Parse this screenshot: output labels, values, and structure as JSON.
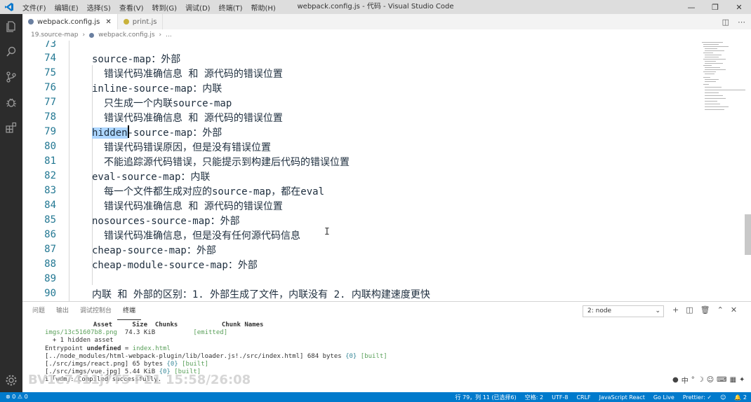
{
  "titlebar": {
    "menu": [
      "文件(F)",
      "编辑(E)",
      "选择(S)",
      "查看(V)",
      "转到(G)",
      "调试(D)",
      "终端(T)",
      "帮助(H)"
    ],
    "title": "webpack.config.js - 代码 - Visual Studio Code"
  },
  "tabs": [
    {
      "label": "webpack.config.js",
      "active": true
    },
    {
      "label": "print.js",
      "active": false
    }
  ],
  "breadcrumb": {
    "folder": "19.source-map",
    "file": "webpack.config.js",
    "more": "..."
  },
  "editor": {
    "lines": [
      {
        "num": "73",
        "text": ""
      },
      {
        "num": "74",
        "text": "source-map：外部"
      },
      {
        "num": "75",
        "text": "错误代码准确信息 和 源代码的错误位置"
      },
      {
        "num": "76",
        "text": "inline-source-map：内联"
      },
      {
        "num": "77",
        "text": "只生成一个内联source-map"
      },
      {
        "num": "78",
        "text": "错误代码准确信息 和 源代码的错误位置"
      },
      {
        "num": "79",
        "text": "hidden",
        "rest": "-source-map：外部"
      },
      {
        "num": "80",
        "text": "错误代码错误原因，但是没有错误位置"
      },
      {
        "num": "81",
        "text": "不能追踪源代码错误，只能提示到构建后代码的错误位置"
      },
      {
        "num": "82",
        "text": "eval-source-map：内联"
      },
      {
        "num": "83",
        "text": "每一个文件都生成对应的source-map，都在eval"
      },
      {
        "num": "84",
        "text": "错误代码准确信息 和 源代码的错误位置"
      },
      {
        "num": "85",
        "text": "nosources-source-map：外部"
      },
      {
        "num": "86",
        "text": "错误代码准确信息，但是没有任何源代码信息"
      },
      {
        "num": "87",
        "text": "cheap-source-map：外部"
      },
      {
        "num": "88",
        "text": "cheap-module-source-map：外部"
      },
      {
        "num": "89",
        "text": ""
      },
      {
        "num": "90",
        "text": "内联 和 外部的区别：1. 外部生成了文件，内联没有 2. 内联构建速度更快"
      }
    ]
  },
  "panel": {
    "tabs": [
      "问题",
      "输出",
      "调试控制台",
      "终端"
    ],
    "terminal_select": "2: node",
    "terminal": {
      "header": {
        "asset": "Asset",
        "size": "Size",
        "chunks": "Chunks",
        "chunk_names": "Chunk Names"
      },
      "row1": {
        "asset": "imgs/13c51607b8.png",
        "size": "74.3 KiB",
        "emitted": "[emitted]"
      },
      "hidden": "+ 1 hidden asset",
      "entry_prefix": "Entrypoint",
      "entry_undef": "undefined",
      "entry_eq": "=",
      "entry_file": "index.html",
      "mod1": "[../node_modules/html-webpack-plugin/lib/loader.js!./src/index.html]",
      "mod1_size": "684 bytes",
      "mod1_chunk": "{0}",
      "mod1_built": "[built]",
      "mod2": "[./src/imgs/react.png]",
      "mod2_size": "65 bytes",
      "mod2_chunk": "{0}",
      "mod2_built": "[built]",
      "mod3": "[./src/imgs/vue.jpg]",
      "mod3_size": "5.44 KiB",
      "mod3_chunk": "{0}",
      "mod3_built": "[built]",
      "wdm": "i ｢wdm｣: Compiled successfully."
    }
  },
  "watermark": "BV1e7411j7T5 P21 15:58/26:08",
  "status": {
    "errors": "⊗ 0 ⚠ 0",
    "position": "行 79，列 11 (已选择6)",
    "spaces": "空格: 2",
    "encoding": "UTF-8",
    "eol": "CRLF",
    "language": "JavaScript React",
    "golive": "Go Live",
    "prettier": "Prettier: ✓",
    "bell": "🔔 2"
  }
}
